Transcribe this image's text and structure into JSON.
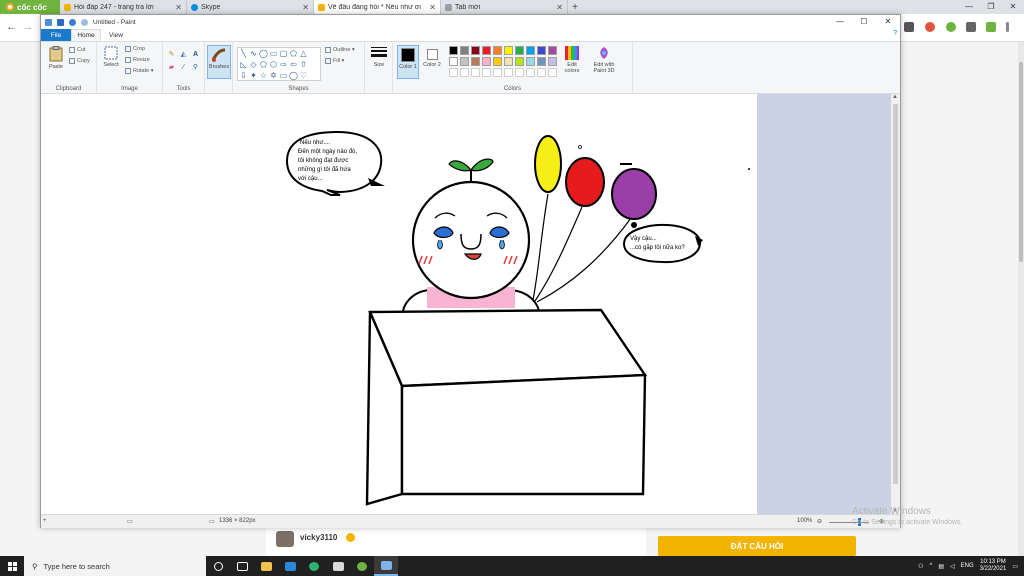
{
  "browser": {
    "brand": "cốc cốc",
    "tabs": [
      {
        "title": "Hỏi đáp 247 - trang tra lời",
        "favicon_color": "#f2b400"
      },
      {
        "title": "Skype",
        "favicon_color": "#0a8ddf"
      },
      {
        "title": "Vẽ đâu đang hỏi * Nếu như ơi",
        "favicon_color": "#f2b400"
      },
      {
        "title": "Tab mới",
        "favicon_color": "#9aa0a6"
      }
    ],
    "active_tab": 2,
    "new_tab": "+",
    "window_controls": [
      "—",
      "❐",
      "✕"
    ],
    "back": "←",
    "forward": "→"
  },
  "paint": {
    "title": "Untitled - Paint",
    "window_controls": [
      "—",
      "☐",
      "✕"
    ],
    "menu": {
      "file": "File",
      "home": "Home",
      "view": "View"
    },
    "help": "?",
    "ribbon": {
      "clipboard": {
        "label": "Clipboard",
        "paste": "Paste",
        "cut": "Cut",
        "copy": "Copy"
      },
      "image": {
        "label": "Image",
        "select": "Select",
        "crop": "Crop",
        "resize": "Resize",
        "rotate": "Rotate ▾"
      },
      "tools": {
        "label": "Tools",
        "brushes": "Brushes"
      },
      "shapes": {
        "label": "Shapes",
        "outline": "Outline ▾",
        "fill": "Fill ▾"
      },
      "size": {
        "label": "Size"
      },
      "colors": {
        "label": "Colors",
        "color1": "Color 1",
        "color2": "Color 2",
        "edit_colors": "Edit colors",
        "edit_paint3d": "Edit with Paint 3D",
        "color1_value": "#000000",
        "color2_value": "#ffffff",
        "palette_row1": [
          "#000000",
          "#7f7f7f",
          "#880015",
          "#ed1c24",
          "#ff7f27",
          "#fff200",
          "#22b14c",
          "#00a2e8",
          "#3f48cc",
          "#a349a4"
        ],
        "palette_row2": [
          "#ffffff",
          "#c3c3c3",
          "#b97a57",
          "#ffaec9",
          "#ffc90e",
          "#efe4b0",
          "#b5e61d",
          "#99d9ea",
          "#7092be",
          "#c8bfe7"
        ]
      }
    },
    "drawing": {
      "speech_left": [
        "Nếu như....",
        "Đến một ngày nào đó,",
        "tôi không đạt được",
        "những gì tôi đã hứa",
        "với cậu..."
      ],
      "speech_right": [
        "Vậy cậu...",
        "...có gặp tôi nữa ko?"
      ],
      "balloon_colors": [
        "#f5ef17",
        "#e61c1c",
        "#9b3fa8"
      ]
    },
    "status": {
      "canvas_size": "1336 × 822px",
      "zoom": "100%",
      "zoom_fraction": 0.75
    }
  },
  "page": {
    "username": "vicky3110",
    "ask_button": "ĐẶT CÂU HỎI",
    "activate_title": "Activate Windows",
    "activate_sub": "Go to Settings to activate Windows."
  },
  "taskbar": {
    "search_placeholder": "Type here to search",
    "lang": "ENG",
    "time": "10:13 PM",
    "date": "3/22/2021"
  }
}
